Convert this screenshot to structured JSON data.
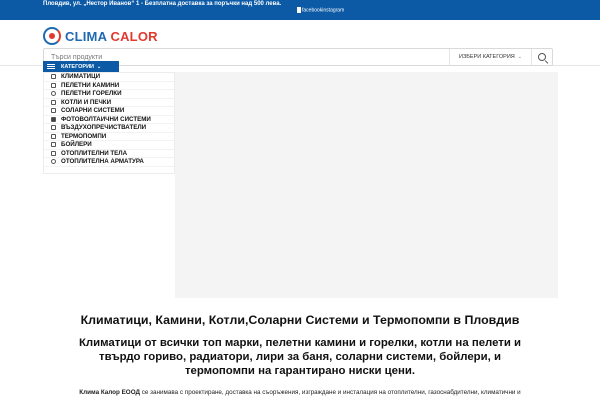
{
  "topbar": {
    "address": "Пловдив, ул. „Нестор Иванов“ 1 - Безплатна доставка за поръчки над 500 лева.",
    "social": "facebookinstagram"
  },
  "logo": {
    "part1": "CLIMA",
    "part2": "CALOR"
  },
  "search": {
    "placeholder": "Търси продукти",
    "category_label": "ИЗБЕРИ КАТЕГОРИЯ",
    "category_chevron": "⌄"
  },
  "categories_button": {
    "label": "КАТЕГОРИИ",
    "chevron": "⌄"
  },
  "categories": [
    {
      "label": "КЛИМАТИЦИ",
      "icon": "air-conditioner-icon"
    },
    {
      "label": "ПЕЛЕТНИ КАМИНИ",
      "icon": "fireplace-icon"
    },
    {
      "label": "ПЕЛЕТНИ ГОРЕЛКИ",
      "icon": "burner-icon"
    },
    {
      "label": "КОТЛИ И ПЕЧКИ",
      "icon": "boiler-stove-icon"
    },
    {
      "label": "СОЛАРНИ СИСТЕМИ",
      "icon": "solar-system-icon"
    },
    {
      "label": "ФОТОВОЛТАИЧНИ СИСТЕМИ",
      "icon": "photovoltaic-icon"
    },
    {
      "label": "ВЪЗДУХОПРЕЧИСТВАТЕЛИ",
      "icon": "air-purifier-icon"
    },
    {
      "label": "ТЕРМОПОМПИ",
      "icon": "heat-pump-icon"
    },
    {
      "label": "БОЙЛЕРИ",
      "icon": "water-heater-icon"
    },
    {
      "label": "ОТОПЛИТЕЛНИ ТЕЛА",
      "icon": "radiator-icon"
    },
    {
      "label": "ОТОПЛИТЕЛНА АРМАТУРА",
      "icon": "fittings-icon"
    }
  ],
  "content": {
    "title": "Климатици, Камини, Котли,Соларни Системи и Термопомпи в Пловдив",
    "subtitle": "Климатици от всички топ марки, пелетни камини и горелки, котли на пелети и твърдо гориво, радиатори, лири за баня, соларни системи, бойлери, и термопомпи на гарантирано ниски цени.",
    "body_company": "Клима Калор ЕООД",
    "body_rest": " се занимава с проектиране, доставка на съоръжения, изграждане и инсталация на отоплителни, газоснабдителни, климатични и"
  },
  "colors": {
    "brand_blue": "#0c5aa5",
    "logo_blue": "#1f69b3",
    "logo_red": "#e03a2f"
  }
}
